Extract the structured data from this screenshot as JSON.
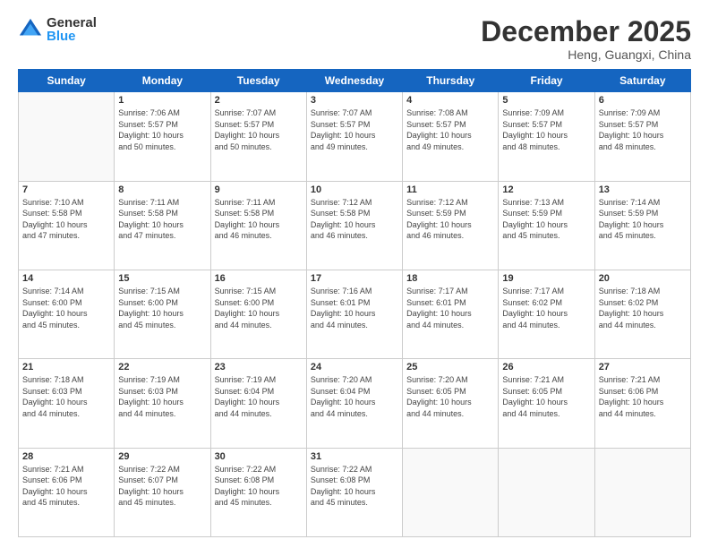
{
  "logo": {
    "general": "General",
    "blue": "Blue"
  },
  "title": {
    "month": "December 2025",
    "location": "Heng, Guangxi, China"
  },
  "days_of_week": [
    "Sunday",
    "Monday",
    "Tuesday",
    "Wednesday",
    "Thursday",
    "Friday",
    "Saturday"
  ],
  "weeks": [
    [
      {
        "day": "",
        "info": ""
      },
      {
        "day": "1",
        "info": "Sunrise: 7:06 AM\nSunset: 5:57 PM\nDaylight: 10 hours\nand 50 minutes."
      },
      {
        "day": "2",
        "info": "Sunrise: 7:07 AM\nSunset: 5:57 PM\nDaylight: 10 hours\nand 50 minutes."
      },
      {
        "day": "3",
        "info": "Sunrise: 7:07 AM\nSunset: 5:57 PM\nDaylight: 10 hours\nand 49 minutes."
      },
      {
        "day": "4",
        "info": "Sunrise: 7:08 AM\nSunset: 5:57 PM\nDaylight: 10 hours\nand 49 minutes."
      },
      {
        "day": "5",
        "info": "Sunrise: 7:09 AM\nSunset: 5:57 PM\nDaylight: 10 hours\nand 48 minutes."
      },
      {
        "day": "6",
        "info": "Sunrise: 7:09 AM\nSunset: 5:57 PM\nDaylight: 10 hours\nand 48 minutes."
      }
    ],
    [
      {
        "day": "7",
        "info": "Sunrise: 7:10 AM\nSunset: 5:58 PM\nDaylight: 10 hours\nand 47 minutes."
      },
      {
        "day": "8",
        "info": "Sunrise: 7:11 AM\nSunset: 5:58 PM\nDaylight: 10 hours\nand 47 minutes."
      },
      {
        "day": "9",
        "info": "Sunrise: 7:11 AM\nSunset: 5:58 PM\nDaylight: 10 hours\nand 46 minutes."
      },
      {
        "day": "10",
        "info": "Sunrise: 7:12 AM\nSunset: 5:58 PM\nDaylight: 10 hours\nand 46 minutes."
      },
      {
        "day": "11",
        "info": "Sunrise: 7:12 AM\nSunset: 5:59 PM\nDaylight: 10 hours\nand 46 minutes."
      },
      {
        "day": "12",
        "info": "Sunrise: 7:13 AM\nSunset: 5:59 PM\nDaylight: 10 hours\nand 45 minutes."
      },
      {
        "day": "13",
        "info": "Sunrise: 7:14 AM\nSunset: 5:59 PM\nDaylight: 10 hours\nand 45 minutes."
      }
    ],
    [
      {
        "day": "14",
        "info": "Sunrise: 7:14 AM\nSunset: 6:00 PM\nDaylight: 10 hours\nand 45 minutes."
      },
      {
        "day": "15",
        "info": "Sunrise: 7:15 AM\nSunset: 6:00 PM\nDaylight: 10 hours\nand 45 minutes."
      },
      {
        "day": "16",
        "info": "Sunrise: 7:15 AM\nSunset: 6:00 PM\nDaylight: 10 hours\nand 44 minutes."
      },
      {
        "day": "17",
        "info": "Sunrise: 7:16 AM\nSunset: 6:01 PM\nDaylight: 10 hours\nand 44 minutes."
      },
      {
        "day": "18",
        "info": "Sunrise: 7:17 AM\nSunset: 6:01 PM\nDaylight: 10 hours\nand 44 minutes."
      },
      {
        "day": "19",
        "info": "Sunrise: 7:17 AM\nSunset: 6:02 PM\nDaylight: 10 hours\nand 44 minutes."
      },
      {
        "day": "20",
        "info": "Sunrise: 7:18 AM\nSunset: 6:02 PM\nDaylight: 10 hours\nand 44 minutes."
      }
    ],
    [
      {
        "day": "21",
        "info": "Sunrise: 7:18 AM\nSunset: 6:03 PM\nDaylight: 10 hours\nand 44 minutes."
      },
      {
        "day": "22",
        "info": "Sunrise: 7:19 AM\nSunset: 6:03 PM\nDaylight: 10 hours\nand 44 minutes."
      },
      {
        "day": "23",
        "info": "Sunrise: 7:19 AM\nSunset: 6:04 PM\nDaylight: 10 hours\nand 44 minutes."
      },
      {
        "day": "24",
        "info": "Sunrise: 7:20 AM\nSunset: 6:04 PM\nDaylight: 10 hours\nand 44 minutes."
      },
      {
        "day": "25",
        "info": "Sunrise: 7:20 AM\nSunset: 6:05 PM\nDaylight: 10 hours\nand 44 minutes."
      },
      {
        "day": "26",
        "info": "Sunrise: 7:21 AM\nSunset: 6:05 PM\nDaylight: 10 hours\nand 44 minutes."
      },
      {
        "day": "27",
        "info": "Sunrise: 7:21 AM\nSunset: 6:06 PM\nDaylight: 10 hours\nand 44 minutes."
      }
    ],
    [
      {
        "day": "28",
        "info": "Sunrise: 7:21 AM\nSunset: 6:06 PM\nDaylight: 10 hours\nand 45 minutes."
      },
      {
        "day": "29",
        "info": "Sunrise: 7:22 AM\nSunset: 6:07 PM\nDaylight: 10 hours\nand 45 minutes."
      },
      {
        "day": "30",
        "info": "Sunrise: 7:22 AM\nSunset: 6:08 PM\nDaylight: 10 hours\nand 45 minutes."
      },
      {
        "day": "31",
        "info": "Sunrise: 7:22 AM\nSunset: 6:08 PM\nDaylight: 10 hours\nand 45 minutes."
      },
      {
        "day": "",
        "info": ""
      },
      {
        "day": "",
        "info": ""
      },
      {
        "day": "",
        "info": ""
      }
    ]
  ]
}
